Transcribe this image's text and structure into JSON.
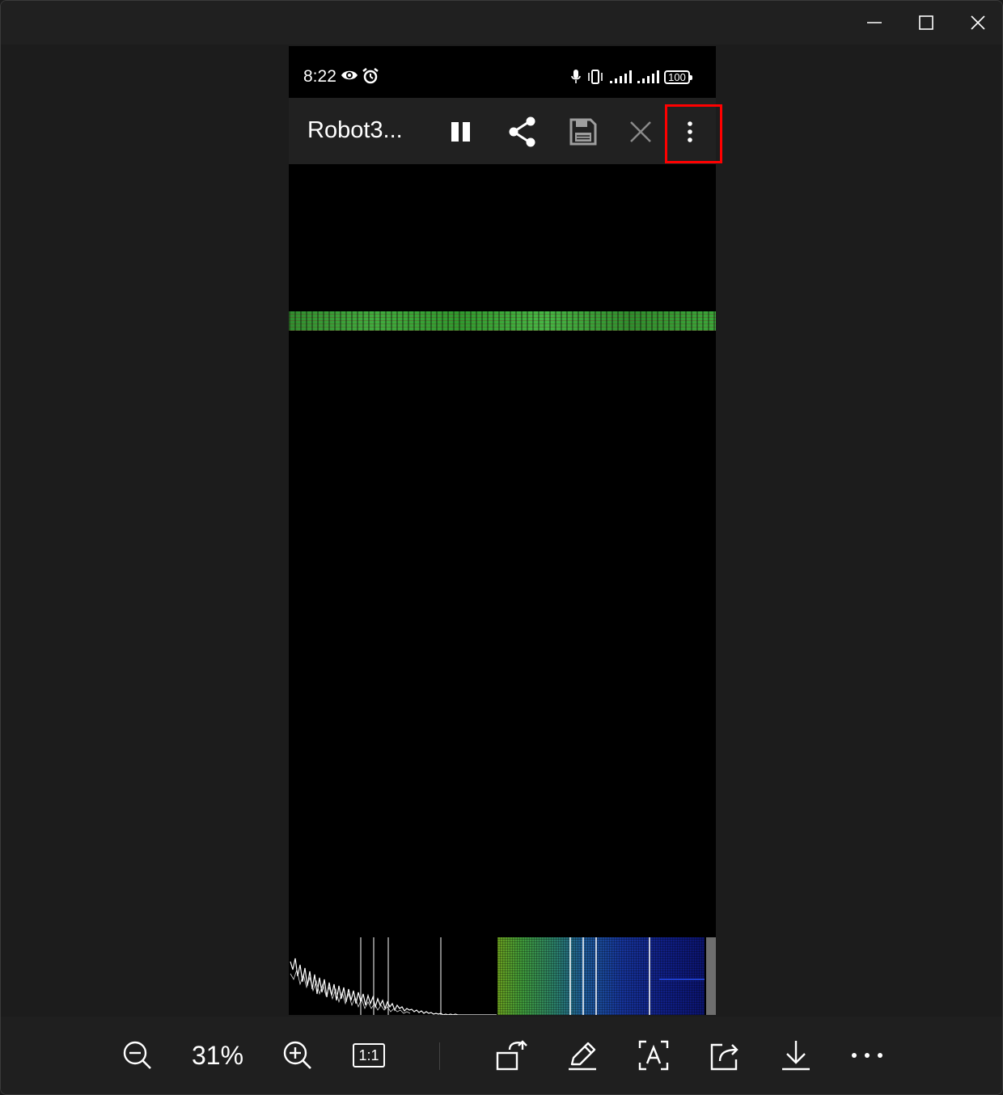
{
  "phone": {
    "status_bar": {
      "time": "8:22",
      "battery": "100",
      "icons": [
        "eye-icon",
        "alarm-icon",
        "mic-icon",
        "vibrate-icon",
        "signal-icon",
        "signal-icon"
      ]
    },
    "app_bar": {
      "title": "Robot3...",
      "actions": [
        "pause-icon",
        "share-icon",
        "save-icon",
        "close-icon",
        "more-vert-icon"
      ]
    }
  },
  "viewer": {
    "zoom": "31%",
    "actual_size_label": "1:1",
    "toolbar_icons": [
      "zoom-out-icon",
      "zoom-in-icon",
      "actual-size-icon",
      "rotate-icon",
      "edit-icon",
      "text-recognition-icon",
      "share-icon",
      "download-icon",
      "more-horizontal-icon"
    ]
  },
  "colors": {
    "highlight": "#ff0000",
    "band_green": "#3aa83a"
  }
}
